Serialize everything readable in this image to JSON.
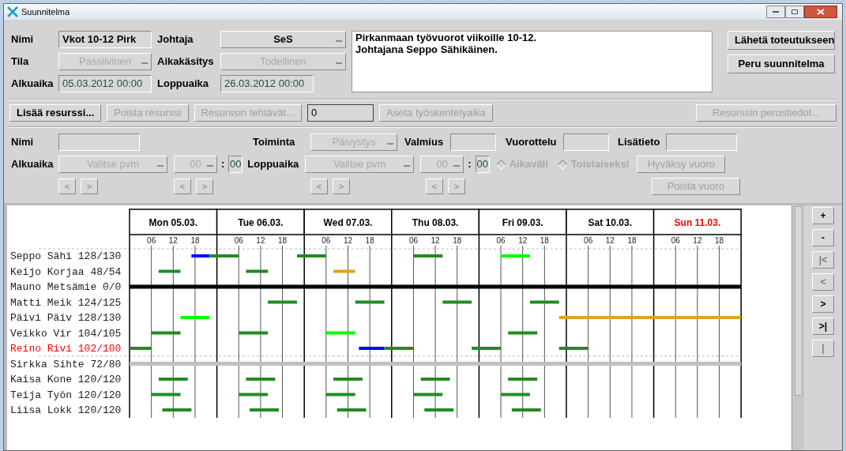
{
  "window": {
    "title": "Suunnitelma"
  },
  "plan": {
    "name": {
      "label": "Nimi",
      "value": "Vkot 10-12 Pirk"
    },
    "leader": {
      "label": "Johtaja",
      "value": "SeS",
      "disabled": false
    },
    "state": {
      "label": "Tila",
      "value": "Passiivinen",
      "disabled": true
    },
    "time_handling": {
      "label": "Aikakäsitys",
      "value": "Todellinen",
      "disabled": true
    },
    "start": {
      "label": "Alkuaika",
      "value": "05.03.2012 00:00"
    },
    "end": {
      "label": "Loppuaika",
      "value": "26.03.2012 00:00"
    },
    "description": [
      "Pirkanmaan työvuorot viikoille 10-12.",
      "Johtajana Seppo Sähikäinen."
    ],
    "buttons": [
      {
        "label": "Lähetä toteutukseen",
        "disabled": false
      },
      {
        "label": "Peru suunnitelma",
        "disabled": false
      }
    ]
  },
  "toolbar": [
    {
      "kind": "button",
      "label": "Lisää resurssi...",
      "disabled": false
    },
    {
      "kind": "button",
      "label": "Poista resurssi",
      "disabled": true
    },
    {
      "kind": "button",
      "label": "Resurssin  tehtävät...",
      "disabled": true
    },
    {
      "kind": "field",
      "value": "0"
    },
    {
      "kind": "button",
      "label": "Aseta työskentelyaika",
      "disabled": true
    },
    {
      "kind": "button",
      "label": "Resurssin perustiedot...",
      "disabled": true
    }
  ],
  "shift_form": {
    "name": {
      "label": "Nimi"
    },
    "activity": {
      "label": "Toiminta",
      "value": "Päivystys",
      "disabled": true
    },
    "readiness": {
      "label": "Valmius"
    },
    "rotation": {
      "label": "Vuorottelu"
    },
    "extra": {
      "label": "Lisätieto"
    },
    "start": {
      "label": "Alkuaika",
      "date": "Valitse pvm",
      "hour": "00",
      "separator": ":",
      "minute": "00"
    },
    "end": {
      "label": "Loppuaika",
      "date": "Valitse pvm",
      "hour": "00",
      "separator": ":",
      "minute": "00"
    },
    "radios": [
      {
        "label": "Aikaväli",
        "selected": false
      },
      {
        "label": "Toistaiseksi",
        "selected": false
      }
    ],
    "arrows": [
      "<",
      ">"
    ],
    "buttons": [
      {
        "label": "Hyväksy vuoro",
        "disabled": true
      },
      {
        "label": "Poista vuoro",
        "disabled": true
      }
    ]
  },
  "chart": {
    "days": [
      {
        "label": "Mon 05.03.",
        "holiday": false
      },
      {
        "label": "Tue 06.03.",
        "holiday": false
      },
      {
        "label": "Wed 07.03.",
        "holiday": false
      },
      {
        "label": "Thu 08.03.",
        "holiday": false
      },
      {
        "label": "Fri 09.03.",
        "holiday": false
      },
      {
        "label": "Sat 10.03.",
        "holiday": false
      },
      {
        "label": "Sun 11.03.",
        "holiday": true
      }
    ],
    "hour_labels": [
      "06",
      "12",
      "18",
      "06",
      "12",
      "18",
      "06",
      "12",
      "18",
      "06",
      "12",
      "18",
      "06",
      "12",
      "18",
      "06",
      "12",
      "18",
      "06",
      "12",
      "18"
    ],
    "resources": [
      {
        "name": "Seppo Sähi 128/130",
        "overbooked": false,
        "kind": "shifts",
        "shifts": [
          {
            "color": "#0000ff"
          },
          {
            "color": "#228b22"
          },
          {
            "color": "#228b22"
          },
          {
            "color": "#228b22"
          },
          {
            "color": "#00ff00"
          }
        ]
      },
      {
        "name": "Keijo Korjaa 48/54",
        "overbooked": false,
        "kind": "shifts",
        "shifts": [
          {
            "color": "#228b22"
          },
          {
            "color": "#228b22"
          },
          {
            "color": "#daa520"
          }
        ]
      },
      {
        "name": "Mauno Metsämie 0/0",
        "overbooked": false,
        "kind": "line",
        "color": "#000000"
      },
      {
        "name": "Matti Meik 124/125",
        "overbooked": false,
        "kind": "shifts",
        "shifts": [
          {
            "color": "#228b22"
          },
          {
            "color": "#228b22"
          },
          {
            "color": "#228b22"
          },
          {
            "color": "#228b22"
          }
        ]
      },
      {
        "name": "Päivi Päiv 128/130",
        "overbooked": false,
        "kind": "shifts",
        "shifts": [
          {
            "color": "#00ff00"
          },
          {
            "color": "#daa520"
          }
        ]
      },
      {
        "name": "Veikko Vir 104/105",
        "overbooked": false,
        "kind": "shifts",
        "shifts": [
          {
            "color": "#228b22"
          },
          {
            "color": "#228b22"
          },
          {
            "color": "#00ff00"
          },
          {
            "color": "#228b22"
          }
        ]
      },
      {
        "name": "Reino Rivi 102/100",
        "overbooked": true,
        "kind": "shifts",
        "shifts": [
          {
            "color": "#228b22"
          },
          {
            "color": "#0000ff"
          },
          {
            "color": "#228b22"
          },
          {
            "color": "#228b22"
          },
          {
            "color": "#228b22"
          }
        ]
      },
      {
        "name": "Sirkka Sihte 72/80",
        "overbooked": false,
        "kind": "line",
        "color": "#c0c0c0"
      },
      {
        "name": "Kaisa Kone 120/120",
        "overbooked": false,
        "kind": "shifts",
        "shifts": [
          {
            "color": "#228b22"
          },
          {
            "color": "#228b22"
          },
          {
            "color": "#228b22"
          },
          {
            "color": "#228b22"
          },
          {
            "color": "#228b22"
          }
        ]
      },
      {
        "name": "Teija Työn 120/120",
        "overbooked": false,
        "kind": "shifts",
        "shifts": [
          {
            "color": "#228b22"
          },
          {
            "color": "#228b22"
          },
          {
            "color": "#228b22"
          },
          {
            "color": "#228b22"
          },
          {
            "color": "#228b22"
          }
        ]
      },
      {
        "name": "Liisa Lokk 120/120",
        "overbooked": false,
        "kind": "shifts",
        "shifts": [
          {
            "color": "#228b22"
          },
          {
            "color": "#228b22"
          },
          {
            "color": "#228b22"
          },
          {
            "color": "#228b22"
          },
          {
            "color": "#228b22"
          }
        ]
      }
    ]
  },
  "side_buttons": [
    {
      "label": "+",
      "disabled": false
    },
    {
      "label": "-",
      "disabled": false
    },
    {
      "label": "|<",
      "disabled": true
    },
    {
      "label": "<",
      "disabled": true
    },
    {
      "label": ">",
      "disabled": false
    },
    {
      "label": ">|",
      "disabled": false
    },
    {
      "label": "|",
      "disabled": true
    }
  ]
}
